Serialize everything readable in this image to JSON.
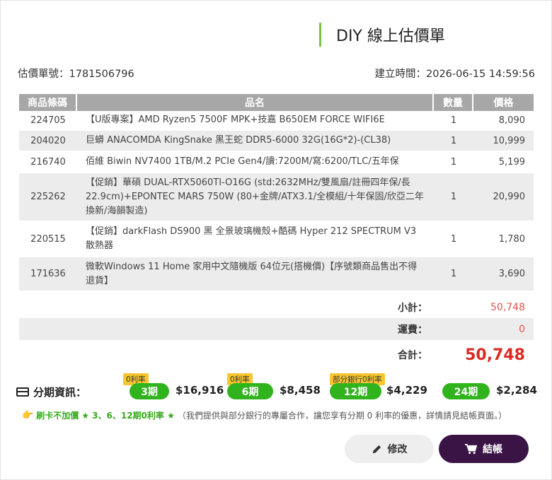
{
  "title": "DIY 線上估價單",
  "quote": {
    "number_label": "估價單號：",
    "number": "1781506796",
    "created_label": "建立時間：",
    "created": "2026-06-15 14:59:56"
  },
  "table": {
    "headers": [
      "商品條碼",
      "品名",
      "數量",
      "價格"
    ],
    "rows": [
      {
        "code": "224705",
        "name": "【U版專案】AMD Ryzen5 7500F MPK+技嘉 B650EM FORCE WIFI6E",
        "qty": "1",
        "price": "8,090"
      },
      {
        "code": "204020",
        "name": "巨蟒 ANACOMDA KingSnake 黑王蛇 DDR5-6000 32G(16G*2)-(CL38)",
        "qty": "1",
        "price": "10,999"
      },
      {
        "code": "216740",
        "name": "佰維 Biwin NV7400 1TB/M.2 PCIe Gen4/讀:7200M/寫:6200/TLC/五年保",
        "qty": "1",
        "price": "5,199"
      },
      {
        "code": "225262",
        "name": "【促銷】華碩 DUAL-RTX5060TI-O16G (std:2632MHz/雙風扇/註冊四年保/長22.9cm)+EPONTEC MARS 750W (80+金牌/ATX3.1/全模組/十年保固/欣亞二年換新/海韻製造)",
        "qty": "1",
        "price": "20,990"
      },
      {
        "code": "220515",
        "name": "【促銷】darkFlash DS900 黑 全景玻璃機殼+酷碼 Hyper 212 SPECTRUM V3 散熱器",
        "qty": "1",
        "price": "1,780"
      },
      {
        "code": "171636",
        "name": "微軟Windows 11 Home 家用中文隨機版 64位元(搭機價)【序號類商品售出不得退貨】",
        "qty": "1",
        "price": "3,690"
      }
    ]
  },
  "summary": {
    "subtotal_label": "小計：",
    "subtotal": "50,748",
    "shipping_label": "運費：",
    "shipping": "0",
    "total_label": "合計：",
    "total": "50,748"
  },
  "installments": {
    "label": "分期資訊：",
    "plans": [
      {
        "tag": "0利率",
        "period": "3期",
        "amount": "$16,916"
      },
      {
        "tag": "0利率",
        "period": "6期",
        "amount": "$8,458"
      },
      {
        "tag": "部分銀行0利率",
        "period": "12期",
        "amount": "$4,229"
      },
      {
        "tag": "",
        "period": "24期",
        "amount": "$2,284"
      }
    ]
  },
  "note": {
    "hand_icon": "👉",
    "highlight1": "刷卡不加價",
    "highlight2": "★ 3、6、12期0利率 ★",
    "text": "（我們提供與部分銀行的專屬合作，讓您享有分期 0 利率的優惠，詳情請見結帳頁面。）"
  },
  "buttons": {
    "edit": "修改",
    "checkout": "結帳"
  },
  "colors": {
    "accent_green": "#31b31d",
    "title_bar": "#76c442",
    "header_gray": "#a7a7a7",
    "total_red": "#dc2a22",
    "checkout_bg": "#3b1446",
    "tag_yellow": "#f7c62f"
  },
  "icons": {
    "card": "credit-card-icon",
    "edit": "pencil-icon",
    "checkout": "cart-icon"
  }
}
